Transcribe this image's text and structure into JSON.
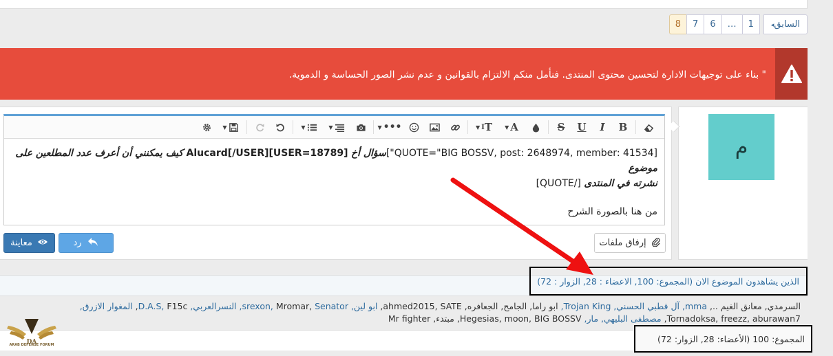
{
  "pagination": {
    "prev_label": "السابق",
    "prev_icon": "chevron-left-icon",
    "pages": [
      "1",
      "…",
      "6",
      "7",
      "8"
    ],
    "current": "8"
  },
  "alert": {
    "icon": "warning-icon",
    "text": "\" بناء على توجيهات الادارة لتحسين محتوى المنتدى. فنأمل منكم الالتزام بالقوانين و عدم نشر الصور الحساسة و الدموية."
  },
  "avatar": {
    "letter": "م",
    "color": "#63cdcc"
  },
  "editor": {
    "toolbar_icons": [
      "eraser-icon",
      "bold-icon",
      "italic-icon",
      "underline-icon",
      "strikethrough-icon",
      "color-drop-icon",
      "font-family-icon",
      "font-size-icon",
      "link-icon",
      "image-icon",
      "smiley-icon",
      "more-icon",
      "camera-icon",
      "align-icon",
      "list-icon",
      "undo-icon",
      "redo-icon",
      "save-icon",
      "gear-icon"
    ],
    "line1_a": "[QUOTE=\"BIG BOSSV, post: 2648974, member: 41534\"]",
    "line1_b": "سؤال أخ",
    "line1_c": "[USER=18789]Alucard[/USER]",
    "line1_d": "كيف يمكنني أن أعرف عدد المطلعين على موضوع",
    "line2_a": "نشرته في المنتدى",
    "line2_b": "[/QUOTE]",
    "line3": "من هنا بالصورة الشرح"
  },
  "buttons": {
    "preview": "معاينة",
    "reply": "رد",
    "attach": "إرفاق ملفات"
  },
  "viewers": {
    "heading": "الذين يشاهدون الموضوع الان (المجموع: 100, الاعضاء : 28, الزوار : 72)",
    "names_line1_plain": "السرمدي, معانق الغيم ..,",
    "names_line1_hl": "mma, آل قطبي الحسني, Trojan King,",
    "names_line1_rest": "ابو راما, الجامح, الجعافره, ahmed2015, SATE,",
    "names_line1_hl2": "ابو لين, srexon,",
    "names_line1_rest2": "Mromar,",
    "names_line1_hl3": "Senator, النسرالعربي, D.A.S,",
    "names_line1_rest3": "F15c,",
    "names_line1_hl4": "المغوار الازرق,",
    "names_line1_rest4": "Tornadoksa, freezz,",
    "names_line2_plain": "aburawan7,",
    "names_line2_hl": "مصطفى البليهي, مار,",
    "names_line2_rest": "Hegesias, moon, BIG BOSSV, مبتدء, Mr fighter"
  },
  "totals": {
    "text": "المجموع: 100 (الأعضاء: 28, الزوار: 72)"
  },
  "logo": {
    "text": "ARAB DEFENSE FORUM",
    "sub": "DA"
  }
}
